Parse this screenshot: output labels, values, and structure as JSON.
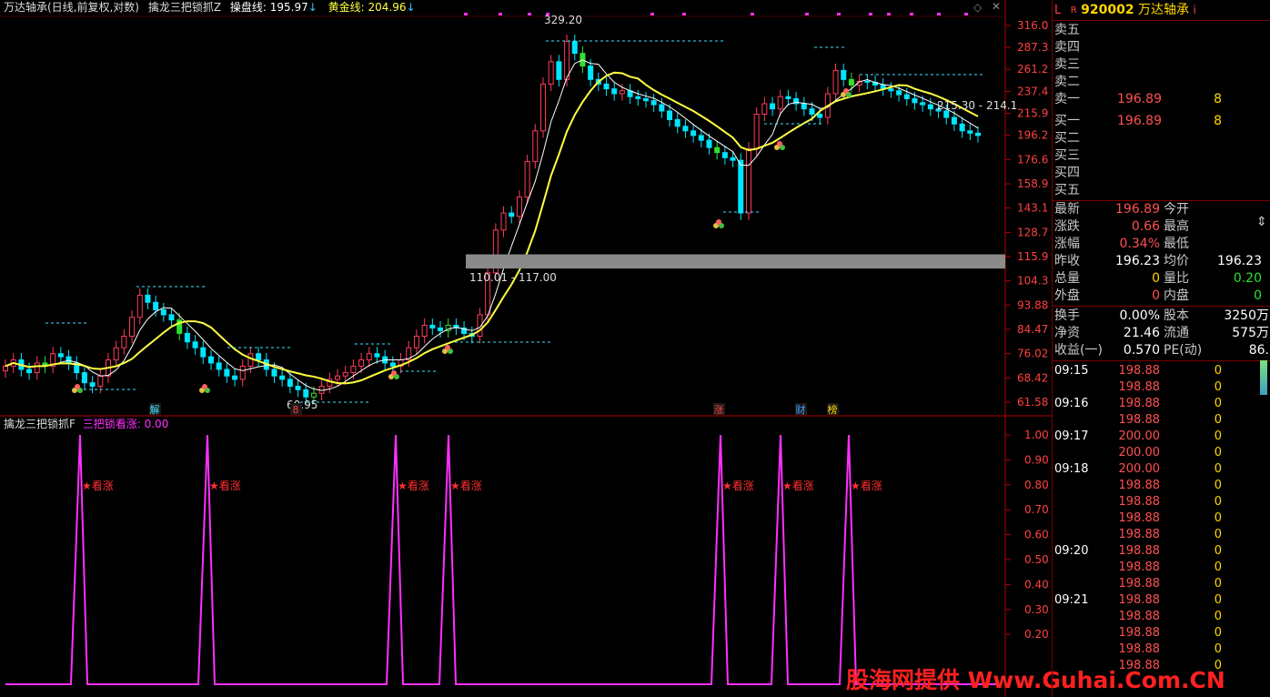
{
  "header": {
    "title": "万达轴承(日线,前复权,对数)",
    "indicator_name": "擒龙三把锁抓Z",
    "caopan_label": "操盘线:",
    "caopan_value": "195.97",
    "huangjin_label": "黄金线:",
    "huangjin_value": "204.96"
  },
  "main_chart": {
    "price_ticks": [
      "316.0",
      "287.3",
      "261.2",
      "237.4",
      "215.9",
      "196.2",
      "176.6",
      "158.9",
      "143.1",
      "128.7",
      "115.9",
      "104.3",
      "93.88",
      "84.47",
      "76.02",
      "68.42",
      "61.58"
    ],
    "annotations": {
      "high": "329.20",
      "low": "60.95",
      "band": "110.01 - 117.00",
      "right_range": "215.30 - 214.1"
    },
    "bottom_tags": [
      "解",
      "8",
      "涨",
      "财",
      "榜"
    ]
  },
  "sub_chart": {
    "indicator_name": "擒龙三把锁抓F",
    "signal_label": "三把锁看涨:",
    "signal_value": "0.00",
    "ticks": [
      "1.00",
      "0.90",
      "0.80",
      "0.70",
      "0.60",
      "0.50",
      "0.40",
      "0.30",
      "0.20"
    ],
    "signal_text": "★看涨",
    "signal_count": 7
  },
  "watermark": "股海网提供 Www.Guhai.Com.CN",
  "stock": {
    "badge_l": "L",
    "badge_r": "R",
    "code": "920002",
    "name": "万达轴承",
    "info_icon": "i"
  },
  "orderbook": {
    "sell": [
      {
        "label": "卖五",
        "price": "",
        "vol": ""
      },
      {
        "label": "卖四",
        "price": "",
        "vol": ""
      },
      {
        "label": "卖三",
        "price": "",
        "vol": ""
      },
      {
        "label": "卖二",
        "price": "",
        "vol": ""
      },
      {
        "label": "卖一",
        "price": "196.89",
        "vol": "8"
      }
    ],
    "buy": [
      {
        "label": "买一",
        "price": "196.89",
        "vol": "8"
      },
      {
        "label": "买二",
        "price": "",
        "vol": ""
      },
      {
        "label": "买三",
        "price": "",
        "vol": ""
      },
      {
        "label": "买四",
        "price": "",
        "vol": ""
      },
      {
        "label": "买五",
        "price": "",
        "vol": ""
      }
    ]
  },
  "quote": [
    {
      "l1": "最新",
      "v1": "196.89",
      "l2": "今开",
      "v2": ""
    },
    {
      "l1": "涨跌",
      "v1": "0.66",
      "l2": "最高",
      "v2": ""
    },
    {
      "l1": "涨幅",
      "v1": "0.34%",
      "l2": "最低",
      "v2": ""
    },
    {
      "l1": "昨收",
      "v1": "196.23",
      "l2": "均价",
      "v2": "196.23"
    },
    {
      "l1": "总量",
      "v1": "0",
      "l2": "量比",
      "v2": "0.20"
    },
    {
      "l1": "外盘",
      "v1": "0",
      "l2": "内盘",
      "v2": "0"
    }
  ],
  "stats": [
    {
      "l1": "换手",
      "v1": "0.00%",
      "l2": "股本",
      "v2": "3250万"
    },
    {
      "l1": "净资",
      "v1": "21.46",
      "l2": "流通",
      "v2": "575万"
    },
    {
      "l1": "收益(一)",
      "v1": "0.570",
      "l2": "PE(动)",
      "v2": "86."
    }
  ],
  "ticks": [
    {
      "time": "09:15",
      "price": "198.88",
      "vol": "0"
    },
    {
      "time": "",
      "price": "198.88",
      "vol": "0"
    },
    {
      "time": "09:16",
      "price": "198.88",
      "vol": "0"
    },
    {
      "time": "",
      "price": "198.88",
      "vol": "0"
    },
    {
      "time": "09:17",
      "price": "200.00",
      "vol": "0"
    },
    {
      "time": "",
      "price": "200.00",
      "vol": "0"
    },
    {
      "time": "09:18",
      "price": "200.00",
      "vol": "0"
    },
    {
      "time": "",
      "price": "198.88",
      "vol": "0"
    },
    {
      "time": "",
      "price": "198.88",
      "vol": "0"
    },
    {
      "time": "",
      "price": "198.88",
      "vol": "0"
    },
    {
      "time": "",
      "price": "198.88",
      "vol": "0"
    },
    {
      "time": "09:20",
      "price": "198.88",
      "vol": "0"
    },
    {
      "time": "",
      "price": "198.88",
      "vol": "0"
    },
    {
      "time": "",
      "price": "198.88",
      "vol": "0"
    },
    {
      "time": "09:21",
      "price": "198.88",
      "vol": "0"
    },
    {
      "time": "",
      "price": "198.88",
      "vol": "0"
    },
    {
      "time": "",
      "price": "198.88",
      "vol": "0"
    },
    {
      "time": "",
      "price": "198.88",
      "vol": "0"
    },
    {
      "time": "",
      "price": "198.88",
      "vol": "0"
    }
  ],
  "colors": {
    "up": "#ff3c5a",
    "down": "#00e5ff",
    "green": "#30e030",
    "ma_yellow": "#ffff40",
    "ma_white": "#ffffff",
    "signal": "#ff30ff",
    "axis": "#b00000",
    "red": "#ff5050",
    "yellow": "#ffd700"
  }
}
